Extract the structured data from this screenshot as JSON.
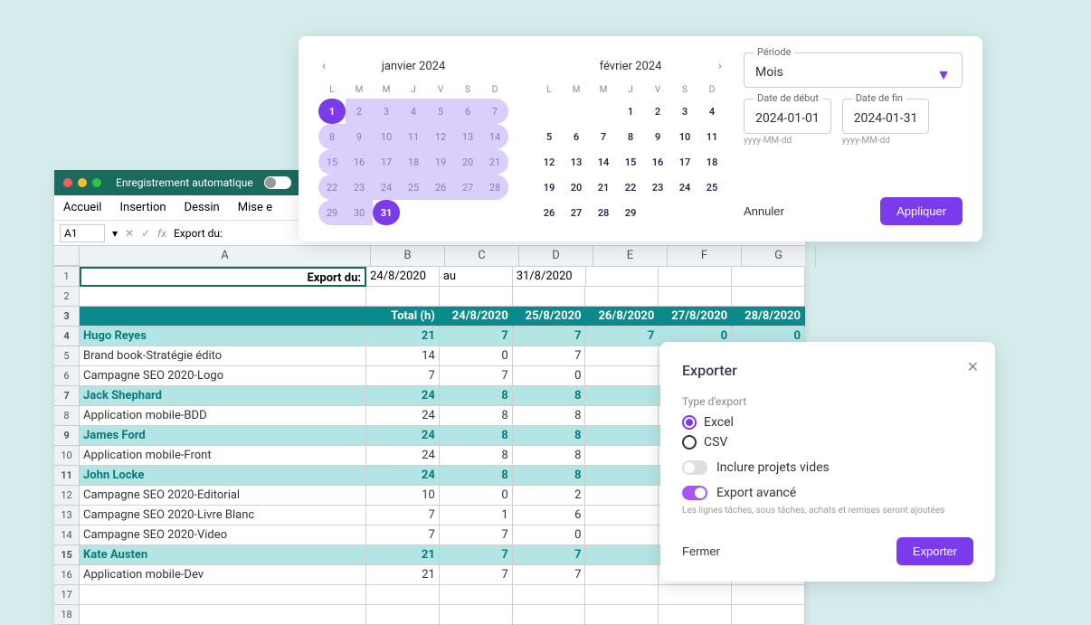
{
  "excel": {
    "autosave_label": "Enregistrement automatique",
    "menu": [
      "Accueil",
      "Insertion",
      "Dessin",
      "Mise e"
    ],
    "cell_ref": "A1",
    "fx_label": "fx",
    "formula_value": "Export du:",
    "col_letters": [
      "A",
      "B",
      "C",
      "D",
      "E",
      "F",
      "G"
    ],
    "row1": {
      "A": "Export du:",
      "B": "24/8/2020",
      "C": "au",
      "D": "31/8/2020"
    },
    "header": {
      "A": "",
      "B": "Total (h)",
      "dates": [
        "24/8/2020",
        "25/8/2020",
        "26/8/2020",
        "27/8/2020",
        "28/8/2020"
      ]
    },
    "rows": [
      {
        "n": 4,
        "type": "person",
        "A": "Hugo Reyes",
        "B": "21",
        "vals": [
          "7",
          "7",
          "7",
          "0",
          "0"
        ]
      },
      {
        "n": 5,
        "type": "project",
        "A": "Brand book-Stratégie édito",
        "B": "14",
        "vals": [
          "0",
          "7",
          "",
          ""
        ]
      },
      {
        "n": 6,
        "type": "project",
        "A": "Campagne SEO 2020-Logo",
        "B": "7",
        "vals": [
          "7",
          "0",
          "",
          ""
        ]
      },
      {
        "n": 7,
        "type": "person",
        "A": "Jack Shephard",
        "B": "24",
        "vals": [
          "8",
          "8",
          "",
          ""
        ]
      },
      {
        "n": 8,
        "type": "project",
        "A": "Application mobile-BDD",
        "B": "24",
        "vals": [
          "8",
          "8",
          "",
          ""
        ]
      },
      {
        "n": 9,
        "type": "person",
        "A": "James Ford",
        "B": "24",
        "vals": [
          "8",
          "8",
          "",
          ""
        ]
      },
      {
        "n": 10,
        "type": "project",
        "A": "Application mobile-Front",
        "B": "24",
        "vals": [
          "8",
          "8",
          "",
          ""
        ]
      },
      {
        "n": 11,
        "type": "person",
        "A": "John Locke",
        "B": "24",
        "vals": [
          "8",
          "8",
          "",
          ""
        ]
      },
      {
        "n": 12,
        "type": "project",
        "A": "Campagne SEO 2020-Editorial",
        "B": "10",
        "vals": [
          "0",
          "2",
          "",
          ""
        ]
      },
      {
        "n": 13,
        "type": "project",
        "A": "Campagne SEO 2020-Livre Blanc",
        "B": "7",
        "vals": [
          "1",
          "6",
          "",
          ""
        ]
      },
      {
        "n": 14,
        "type": "project",
        "A": "Campagne SEO 2020-Video",
        "B": "7",
        "vals": [
          "7",
          "0",
          "",
          ""
        ]
      },
      {
        "n": 15,
        "type": "person",
        "A": "Kate Austen",
        "B": "21",
        "vals": [
          "7",
          "7",
          "",
          ""
        ]
      },
      {
        "n": 16,
        "type": "project",
        "A": "Application mobile-Dev",
        "B": "21",
        "vals": [
          "7",
          "7",
          "",
          ""
        ]
      },
      {
        "n": 17,
        "type": "blank"
      },
      {
        "n": 18,
        "type": "blank"
      }
    ]
  },
  "datepicker": {
    "month1": "janvier 2024",
    "month2": "février 2024",
    "dows": [
      "L",
      "M",
      "M",
      "J",
      "V",
      "S",
      "D"
    ],
    "jan_days": [
      1,
      2,
      3,
      4,
      5,
      6,
      7,
      8,
      9,
      10,
      11,
      12,
      13,
      14,
      15,
      16,
      17,
      18,
      19,
      20,
      21,
      22,
      23,
      24,
      25,
      26,
      27,
      28,
      29,
      30,
      31
    ],
    "feb_blanks": 3,
    "feb_days": [
      1,
      2,
      3,
      4,
      5,
      6,
      7,
      8,
      9,
      10,
      11,
      12,
      13,
      14,
      15,
      16,
      17,
      18,
      19,
      20,
      21,
      22,
      23,
      24,
      25,
      26,
      27,
      28,
      29
    ],
    "period_label": "Période",
    "period_value": "Mois",
    "start_label": "Date de début",
    "start_value": "2024-01-01",
    "end_label": "Date de fin",
    "end_value": "2024-01-31",
    "format_hint": "yyyy-MM-dd",
    "cancel": "Annuler",
    "apply": "Appliquer"
  },
  "export": {
    "title": "Exporter",
    "type_label": "Type d'export",
    "option_excel": "Excel",
    "option_csv": "CSV",
    "include_empty": "Inclure projets vides",
    "advanced": "Export avancé",
    "advanced_hint": "Les lignes tâches, sous tâches, achats et remises seront ajoutées",
    "close": "Fermer",
    "export_btn": "Exporter"
  }
}
